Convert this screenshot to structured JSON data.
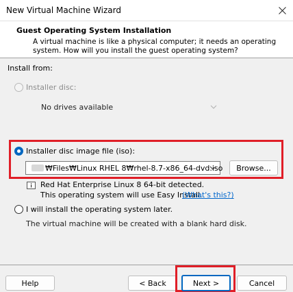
{
  "window": {
    "title": "New Virtual Machine Wizard"
  },
  "header": {
    "title": "Guest Operating System Installation",
    "description_line1": "A virtual machine is like a physical computer; it needs an operating",
    "description_line2": "system. How will you install the guest operating system?"
  },
  "install_from": {
    "label": "Install from:",
    "disc_option": {
      "label": "Installer disc:",
      "selected": false,
      "enabled": false,
      "dropdown_value": "No drives available"
    },
    "iso_option": {
      "label": "Installer disc image file (iso):",
      "selected": true,
      "path_value": "₩Files₩Linux RHEL 8₩rhel-8.7-x86_64-dvd.iso",
      "browse_label": "Browse...",
      "detected_text": "Red Hat Enterprise Linux 8 64-bit detected.",
      "easy_install_text": "This operating system will use Easy Install.",
      "whats_this_link": "(What's this?)"
    },
    "later_option": {
      "label": "I will install the operating system later.",
      "selected": false,
      "note": "The virtual machine will be created with a blank hard disk."
    }
  },
  "footer": {
    "help_label": "Help",
    "back_label": "< Back",
    "next_label": "Next >",
    "cancel_label": "Cancel"
  },
  "colors": {
    "accent": "#0067c0",
    "highlight": "#e01e27",
    "link": "#0066cc"
  },
  "icons": [
    "close-icon",
    "chevron-down-icon",
    "info-icon"
  ]
}
